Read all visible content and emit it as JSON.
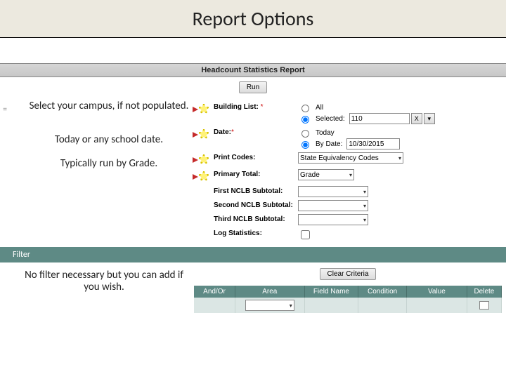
{
  "slide": {
    "title": "Report Options"
  },
  "panel": {
    "title": "Headcount Statistics Report",
    "run": "Run"
  },
  "annotations": {
    "campus": "Select your campus, if not populated.",
    "date": "Today or any school date.",
    "grade": "Typically run by Grade.",
    "filter": "No filter necessary but you can add if you wish."
  },
  "form": {
    "building": {
      "label": "Building List:",
      "required": "*",
      "all_label": "All",
      "selected_label": "Selected:",
      "selected_value": "110",
      "all_checked": false,
      "selected_checked": true
    },
    "date": {
      "label": "Date:",
      "required": "*",
      "today_label": "Today",
      "bydate_label": "By Date:",
      "bydate_value": "10/30/2015",
      "today_checked": false,
      "bydate_checked": true
    },
    "print_codes": {
      "label": "Print Codes:",
      "value": "State Equivalency Codes"
    },
    "primary_total": {
      "label": "Primary Total:",
      "value": "Grade"
    },
    "first_nclb": {
      "label": "First NCLB Subtotal:",
      "value": ""
    },
    "second_nclb": {
      "label": "Second NCLB Subtotal:",
      "value": ""
    },
    "third_nclb": {
      "label": "Third NCLB Subtotal:",
      "value": ""
    },
    "log_stats": {
      "label": "Log Statistics:"
    }
  },
  "filter": {
    "bar_label": "Filter",
    "clear": "Clear Criteria",
    "headers": {
      "andor": "And/Or",
      "area": "Area",
      "field": "Field Name",
      "condition": "Condition",
      "value": "Value",
      "delete": "Delete"
    }
  }
}
